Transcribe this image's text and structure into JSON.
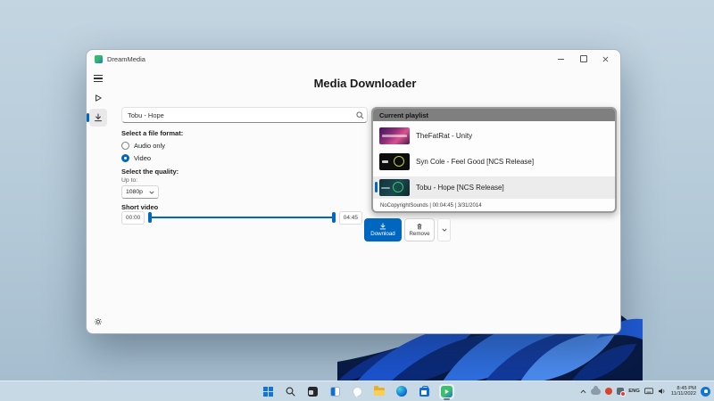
{
  "colors": {
    "accent": "#0067c0",
    "desktop": "#b4c9d8",
    "taskbar": "#c9dae7",
    "playlist_header_bg": "#7f7f7f",
    "bloom_dark": "#081a44",
    "bloom_bright": "#2f6fe0"
  },
  "window": {
    "titlebar": {
      "app_name": "DreamMedia",
      "controls": [
        "minimize",
        "maximize",
        "close"
      ]
    },
    "sidebar": {
      "items": [
        "menu",
        "play",
        "downloads",
        "settings"
      ],
      "active": "downloads"
    },
    "main": {
      "title": "Media Downloader",
      "search": {
        "value": "Tobu - Hope",
        "icon": "search-icon"
      },
      "format": {
        "label": "Select a file format:",
        "options": [
          {
            "label": "Audio only",
            "selected": false
          },
          {
            "label": "Video",
            "selected": true
          }
        ]
      },
      "quality": {
        "label": "Select the quality:",
        "sublabel": "Up to:",
        "value": "1080p"
      },
      "trim": {
        "label": "Short video",
        "start": "00:00",
        "end": "04:45"
      },
      "actions": {
        "download": "Download",
        "remove": "Remove"
      }
    },
    "playlist": {
      "header": "Current playlist",
      "items": [
        {
          "title": "TheFatRat - Unity",
          "selected": false
        },
        {
          "title": "Syn Cole - Feel Good [NCS Release]",
          "selected": false
        },
        {
          "title": "Tobu - Hope [NCS Release]",
          "selected": true
        }
      ],
      "selected_meta": "NoCopyrightSounds | 00:04:45 | 3/31/2014"
    }
  },
  "taskbar": {
    "icons": [
      "start",
      "search",
      "task-view",
      "widgets",
      "chat",
      "file-explorer",
      "edge",
      "store",
      "dreammedia"
    ],
    "active_icon": "dreammedia",
    "tray": {
      "hidden_icons": [
        "chevron-up",
        "onedrive",
        "alert",
        "app-badge"
      ],
      "language": "ENG",
      "icons": [
        "touch-keyboard",
        "volume"
      ],
      "time": "8:45 PM",
      "date": "11/11/2022",
      "notification": "notification-badge"
    }
  }
}
